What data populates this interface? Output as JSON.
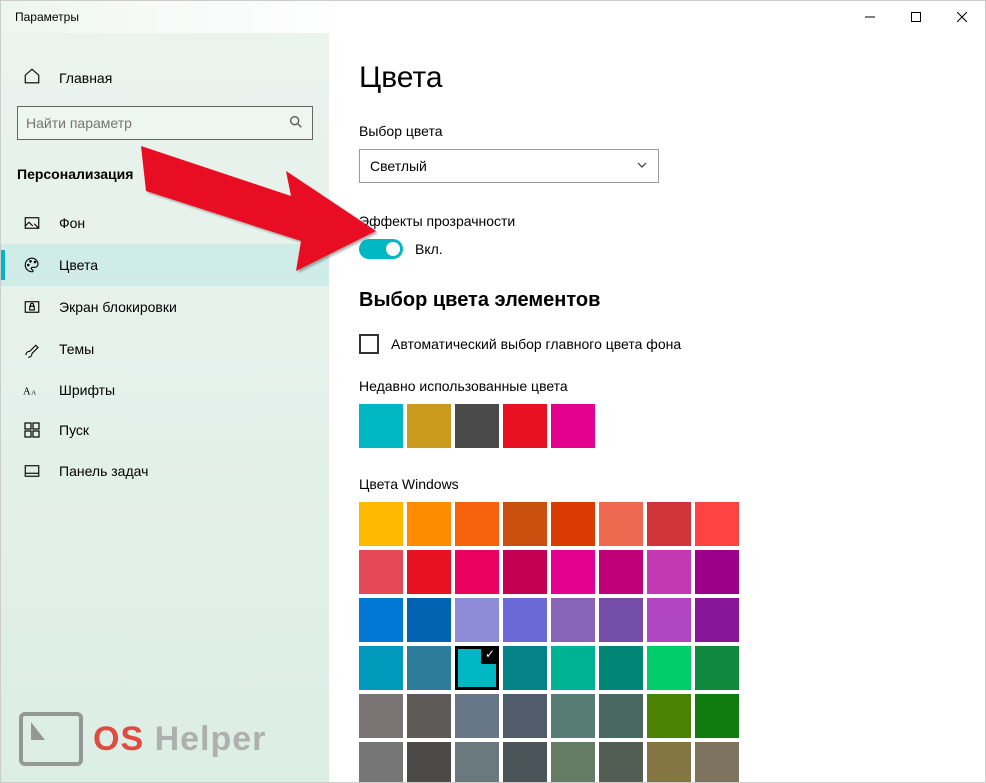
{
  "window": {
    "title": "Параметры"
  },
  "sidebar": {
    "home": "Главная",
    "search_placeholder": "Найти параметр",
    "section": "Персонализация",
    "items": [
      {
        "label": "Фон"
      },
      {
        "label": "Цвета"
      },
      {
        "label": "Экран блокировки"
      },
      {
        "label": "Темы"
      },
      {
        "label": "Шрифты"
      },
      {
        "label": "Пуск"
      },
      {
        "label": "Панель задач"
      }
    ]
  },
  "main": {
    "title": "Цвета",
    "color_mode_label": "Выбор цвета",
    "color_mode_value": "Светлый",
    "transparency_label": "Эффекты прозрачности",
    "transparency_state": "Вкл.",
    "accent_heading": "Выбор цвета элементов",
    "auto_pick_label": "Автоматический выбор главного цвета фона",
    "recent_label": "Недавно использованные цвета",
    "recent_colors": [
      "#00b7c3",
      "#ca9b1c",
      "#4a4a4a",
      "#e81123",
      "#e3008c"
    ],
    "windows_colors_label": "Цвета Windows",
    "windows_colors": [
      "#ffb900",
      "#ff8c00",
      "#f7630c",
      "#ca5010",
      "#da3b01",
      "#ef6950",
      "#d13438",
      "#ff4343",
      "#e74856",
      "#e81123",
      "#ea005e",
      "#c30052",
      "#e3008c",
      "#bf0077",
      "#c239b3",
      "#9a0089",
      "#0078d4",
      "#0063b1",
      "#8e8cd8",
      "#6b69d6",
      "#8764b8",
      "#744da9",
      "#b146c2",
      "#881798",
      "#0099bc",
      "#2d7d9a",
      "#00b7c3",
      "#038387",
      "#00b294",
      "#018574",
      "#00cc6a",
      "#10893e",
      "#7a7574",
      "#5d5a58",
      "#68768a",
      "#515c6b",
      "#567c73",
      "#486860",
      "#498205",
      "#107c10",
      "#767676",
      "#4c4a48",
      "#69797e",
      "#4a5459",
      "#647c64",
      "#525e54",
      "#847545",
      "#7e735f"
    ],
    "selected_color_index": 26
  },
  "watermark": {
    "text_a": "OS",
    "text_b": " Helper"
  },
  "accent": "#00b7c3"
}
